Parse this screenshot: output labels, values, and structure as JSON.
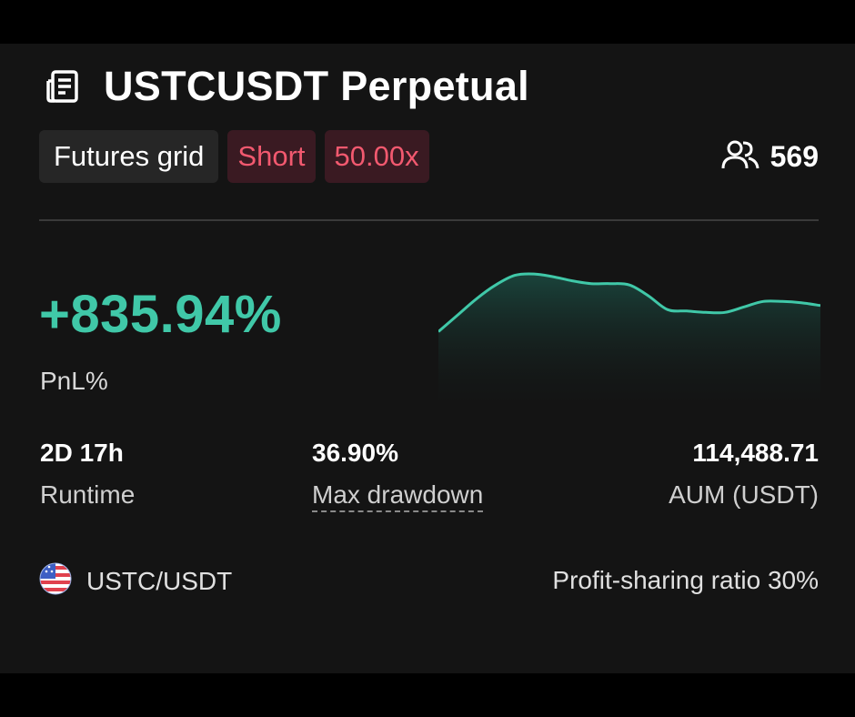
{
  "card": {
    "title": "USTCUSDT Perpetual",
    "title_icon": "document-icon",
    "tags": [
      {
        "label": "Futures grid",
        "style": "neutral"
      },
      {
        "label": "Short",
        "style": "red"
      },
      {
        "label": "50.00x",
        "style": "red"
      }
    ],
    "followers": {
      "icon": "users-icon",
      "count": "569"
    },
    "pnl": {
      "value": "+835.94%",
      "label": "PnL%"
    },
    "stats": [
      {
        "value": "2D 17h",
        "label": "Runtime"
      },
      {
        "value": "36.90%",
        "label": "Max drawdown"
      },
      {
        "value": "114,488.71",
        "label": "AUM (USDT)"
      }
    ],
    "pair": {
      "icon": "coin-icon",
      "label": "USTC/USDT"
    },
    "profit_sharing": "Profit-sharing ratio 30%"
  },
  "colors": {
    "positive": "#40c8a8",
    "short_text": "#f2596f",
    "short_bg": "#3a1a22",
    "card_bg": "#141414"
  },
  "chart_data": {
    "type": "area",
    "x": [
      0,
      1,
      2,
      3,
      4,
      5,
      6,
      7,
      8,
      9,
      10,
      11,
      12,
      13,
      14,
      15,
      16,
      17,
      18,
      19,
      20
    ],
    "values": [
      58,
      70,
      82,
      92,
      99,
      100,
      98,
      95,
      93,
      93,
      92,
      84,
      74,
      73,
      72,
      72,
      76,
      80,
      80,
      79,
      77
    ],
    "ylim": [
      0,
      110
    ],
    "grid": false,
    "axes": false
  }
}
